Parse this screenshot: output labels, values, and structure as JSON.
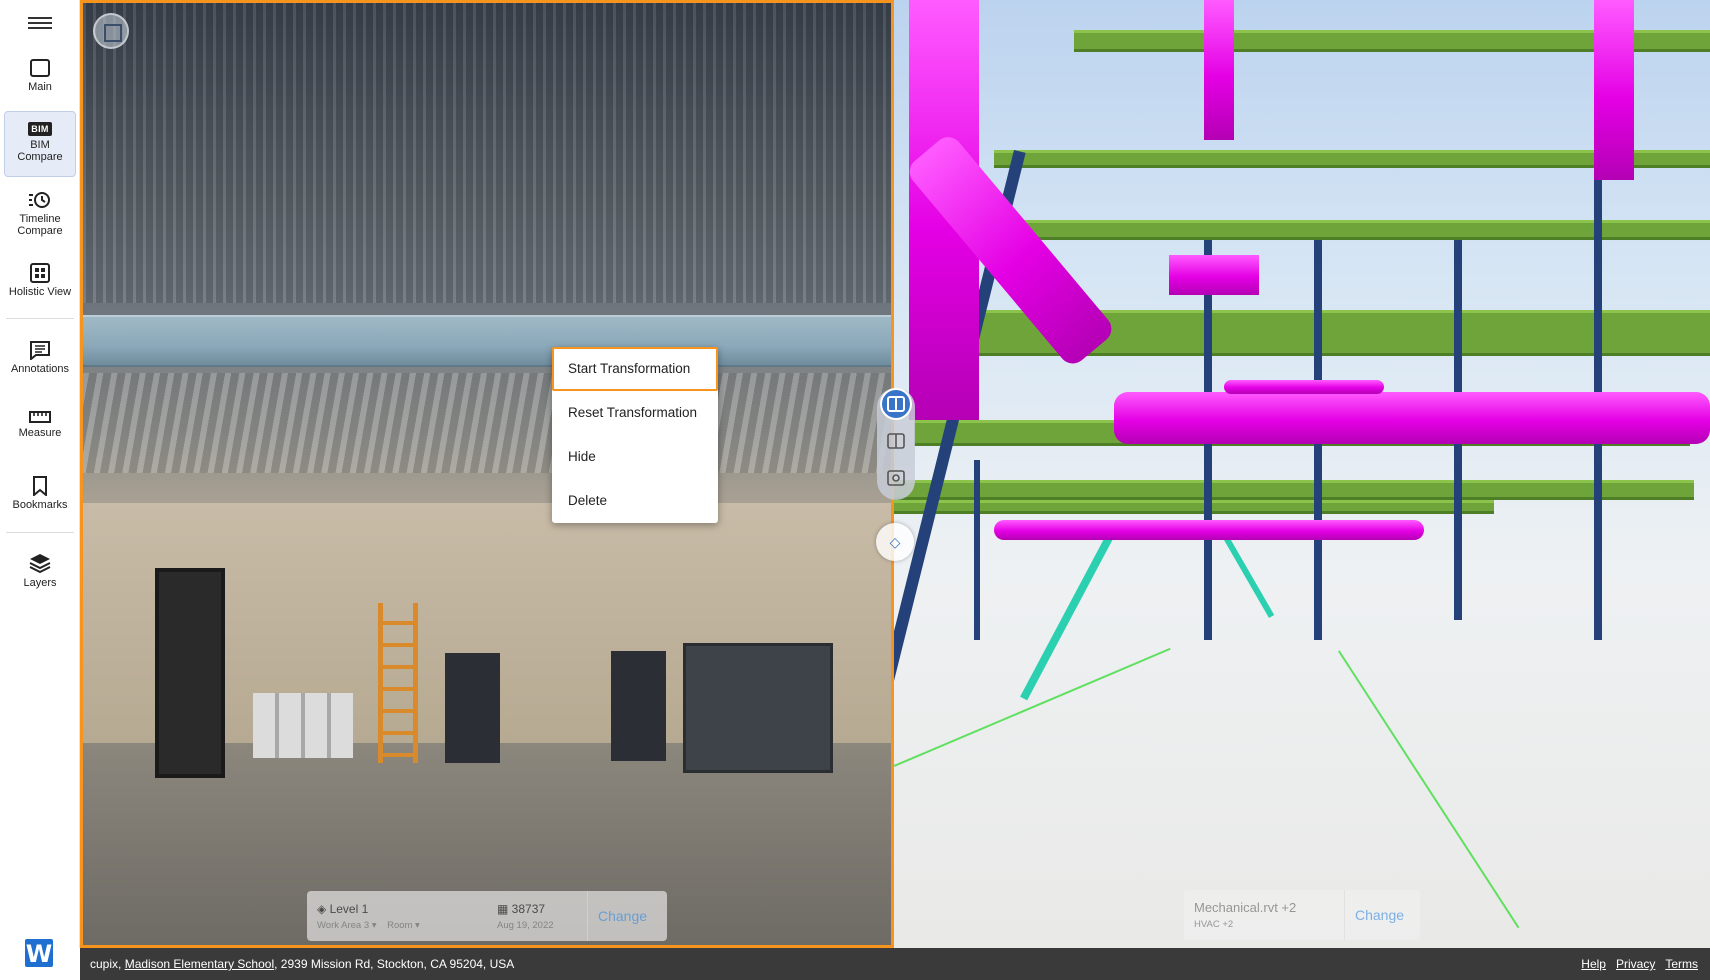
{
  "sidebar": {
    "items": [
      {
        "label": "Main",
        "icon": "square-icon"
      },
      {
        "label": "BIM\nCompare",
        "icon": "bim-icon",
        "badge": "BIM",
        "active": true
      },
      {
        "label": "Timeline\nCompare",
        "icon": "timeline-icon"
      },
      {
        "label": "Holistic View",
        "icon": "grid-icon"
      },
      {
        "label": "Annotations",
        "icon": "annotation-icon"
      },
      {
        "label": "Measure",
        "icon": "ruler-icon"
      },
      {
        "label": "Bookmarks",
        "icon": "bookmark-icon"
      },
      {
        "label": "Layers",
        "icon": "layers-icon"
      }
    ],
    "logo_letter": "W"
  },
  "context_menu": {
    "items": [
      "Start Transformation",
      "Reset Transformation",
      "Hide",
      "Delete"
    ]
  },
  "capture_info": {
    "level": "Level 1",
    "work_area": "Work Area 3",
    "room": "Room",
    "capture_id": "38737",
    "date": "Aug 19, 2022",
    "change_label": "Change"
  },
  "model_info": {
    "file": "Mechanical.rvt +2",
    "sub": "HVAC +2",
    "change_label": "Change"
  },
  "status_bar": {
    "company": "cupix,",
    "project": "Madison Elementary School",
    "address": ", 2939 Mission Rd, Stockton, CA 95204, USA",
    "links": [
      "Help",
      "Privacy",
      "Terms"
    ]
  },
  "colors": {
    "accent": "#f7941d",
    "brand": "#1f6fd1",
    "duct": "#e400e4",
    "steel": "#6fa43a",
    "column": "#24417a"
  }
}
